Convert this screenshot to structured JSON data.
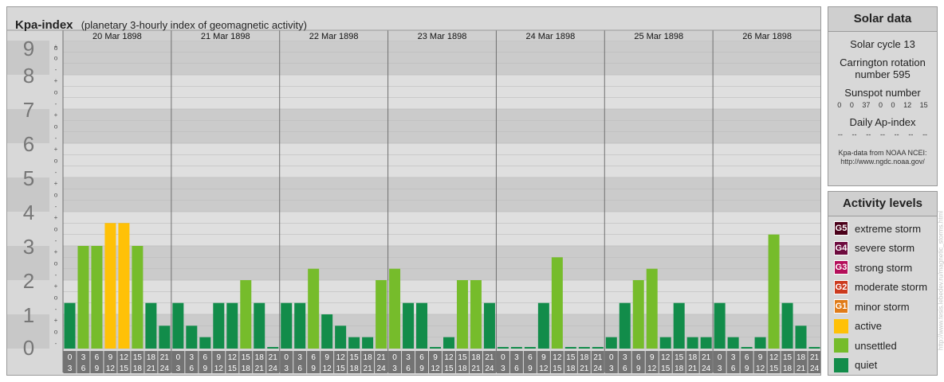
{
  "title": {
    "bold": "Kpa-index",
    "subtitle": "(planetary 3-hourly index of geomagnetic activity)"
  },
  "chart_data": {
    "type": "bar",
    "title": "Kpa-index",
    "subtitle": "(planetary 3-hourly index of geomagnetic activity)",
    "ylim": [
      0,
      9
    ],
    "y_ticks": [
      "0",
      "1",
      "2",
      "3",
      "4",
      "5",
      "6",
      "7",
      "8",
      "9"
    ],
    "sub_ticks": [
      "-",
      "o",
      "+"
    ],
    "days": [
      "20 Mar 1898",
      "21 Mar 1898",
      "22 Mar 1898",
      "23 Mar 1898",
      "24 Mar 1898",
      "25 Mar 1898",
      "26 Mar 1898"
    ],
    "interval_labels": [
      [
        "0",
        "3"
      ],
      [
        "3",
        "6"
      ],
      [
        "6",
        "9"
      ],
      [
        "9",
        "12"
      ],
      [
        "12",
        "15"
      ],
      [
        "15",
        "18"
      ],
      [
        "18",
        "21"
      ],
      [
        "21",
        "24"
      ]
    ],
    "values": [
      [
        1.333,
        3,
        3,
        3.667,
        3.667,
        3,
        1.333,
        0.667
      ],
      [
        1.333,
        0.667,
        0.333,
        1.333,
        1.333,
        2,
        1.333,
        0
      ],
      [
        1.333,
        1.333,
        2.333,
        1,
        0.667,
        0.333,
        0.333,
        2
      ],
      [
        2.333,
        1.333,
        1.333,
        0,
        0.333,
        2,
        2,
        1.333
      ],
      [
        0,
        0,
        0,
        1.333,
        2.667,
        0,
        0,
        0
      ],
      [
        0.333,
        1.333,
        2,
        2.333,
        0.333,
        1.333,
        0.333,
        0.333
      ],
      [
        1.333,
        0.333,
        0,
        0.333,
        3.333,
        1.333,
        0.667,
        0
      ]
    ],
    "colors": {
      "quiet": "#128c4a",
      "unsettled": "#76bc2b",
      "active": "#ffc107",
      "g1": "#e07b18",
      "g2": "#cc3a1e",
      "g3": "#b40e5a",
      "g4": "#6d0b3e",
      "g5": "#4a0019"
    },
    "grid": true
  },
  "solar": {
    "title": "Solar data",
    "cycle": "Solar cycle 13",
    "carrington": "Carrington rotation number 595",
    "sunspot_title": "Sunspot number",
    "sunspot_values": [
      "0",
      "0",
      "37",
      "0",
      "0",
      "12",
      "15"
    ],
    "ap_title": "Daily Ap-index",
    "ap_values": [
      "--",
      "--",
      "--",
      "--",
      "--",
      "--",
      "--"
    ],
    "credit": "Kpa-data from NOAA NCEI: http://www.ngdc.noaa.gov/"
  },
  "activity": {
    "title": "Activity levels",
    "items": [
      {
        "badge": "G5",
        "label": "extreme storm",
        "color": "#4a0019"
      },
      {
        "badge": "G4",
        "label": "severe storm",
        "color": "#6d0b3e"
      },
      {
        "badge": "G3",
        "label": "strong storm",
        "color": "#b40e5a"
      },
      {
        "badge": "G2",
        "label": "moderate storm",
        "color": "#cc3a1e"
      },
      {
        "badge": "G1",
        "label": "minor storm",
        "color": "#e07b18"
      },
      {
        "badge": "",
        "label": "active",
        "color": "#ffc107"
      },
      {
        "badge": "",
        "label": "unsettled",
        "color": "#76bc2b"
      },
      {
        "badge": "",
        "label": "quiet",
        "color": "#128c4a"
      }
    ]
  },
  "watermark": "http://www.tesis.lebedev.ru/magnetic_storms.html"
}
